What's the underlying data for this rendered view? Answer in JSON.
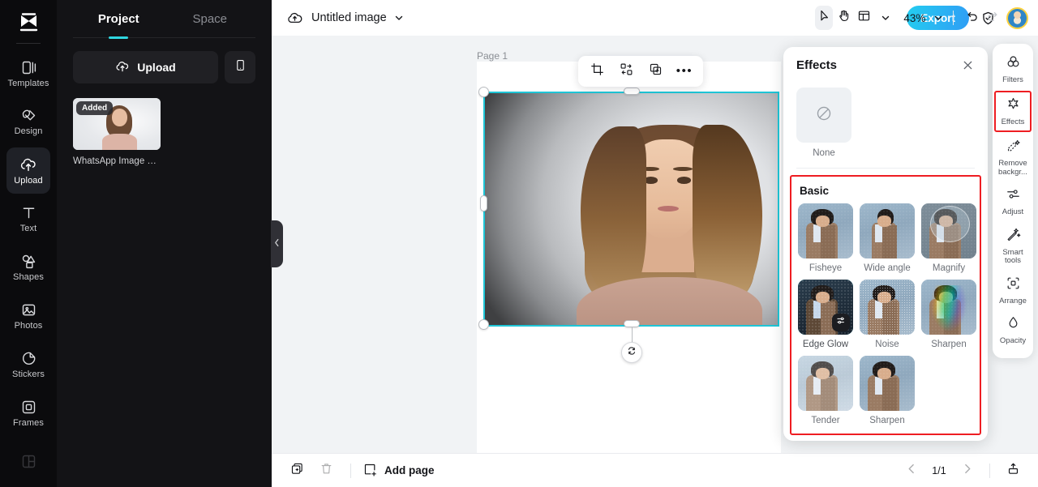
{
  "left_rail": {
    "logo_name": "capcut-logo",
    "items": [
      {
        "label": "Templates",
        "icon": "templates-icon",
        "active": false
      },
      {
        "label": "Design",
        "icon": "design-icon",
        "active": false
      },
      {
        "label": "Upload",
        "icon": "upload-cloud-icon",
        "active": true
      },
      {
        "label": "Text",
        "icon": "text-icon",
        "active": false
      },
      {
        "label": "Shapes",
        "icon": "shapes-icon",
        "active": false
      },
      {
        "label": "Photos",
        "icon": "photos-icon",
        "active": false
      },
      {
        "label": "Stickers",
        "icon": "stickers-icon",
        "active": false
      },
      {
        "label": "Frames",
        "icon": "frames-icon",
        "active": false
      }
    ]
  },
  "side_panel": {
    "tabs": [
      {
        "label": "Project",
        "active": true
      },
      {
        "label": "Space",
        "active": false
      }
    ],
    "upload_button": "Upload",
    "mobile_button_icon": "mobile-phone-icon",
    "assets": [
      {
        "badge": "Added",
        "name": "WhatsApp Image 20..."
      }
    ],
    "collapse_icon": "chevron-left-icon"
  },
  "topbar": {
    "cloud_icon": "cloud-saved-icon",
    "doc_title": "Untitled image",
    "title_caret": "chevron-down-icon",
    "tools": [
      {
        "name": "select-tool",
        "icon": "cursor-arrow-icon",
        "active": true
      },
      {
        "name": "hand-tool",
        "icon": "hand-icon",
        "active": false
      },
      {
        "name": "view-layout-tool",
        "icon": "layout-grid-icon",
        "active": false
      }
    ],
    "view_caret": "chevron-down-icon",
    "zoom_value": "43%",
    "zoom_caret": "chevron-down-icon",
    "undo_icon": "undo-arrow-icon",
    "redo_icon": "redo-arrow-icon",
    "export_label": "Export",
    "shield_icon": "shield-check-icon",
    "avatar_name": "user-avatar"
  },
  "canvas": {
    "page_label": "Page 1",
    "float_toolbar": [
      {
        "name": "crop-button",
        "icon": "crop-icon"
      },
      {
        "name": "replace-button",
        "icon": "replace-image-icon"
      },
      {
        "name": "duplicate-button",
        "icon": "duplicate-icon"
      },
      {
        "name": "more-button",
        "icon": "more-dots-icon",
        "label": "•••"
      }
    ],
    "rotate_icon": "rotate-handle-icon",
    "selection_color": "#1ec5d6"
  },
  "bottombar": {
    "duplicate_page_icon": "duplicate-page-icon",
    "delete_page_icon": "trash-icon",
    "add_page_label": "Add page",
    "add_page_icon": "add-page-icon",
    "prev_icon": "chevron-left-icon",
    "page_count": "1/1",
    "next_icon": "chevron-right-icon",
    "export_icon": "export-upload-icon"
  },
  "effects_panel": {
    "title": "Effects",
    "close_icon": "close-icon",
    "none": {
      "label": "None",
      "icon": "no-effect-icon"
    },
    "section_title": "Basic",
    "highlight_color": "#ee1d22",
    "effects": [
      {
        "label": "Fisheye",
        "variant": "v-fish",
        "selected": false
      },
      {
        "label": "Wide angle",
        "variant": "v-wide",
        "selected": false
      },
      {
        "label": "Magnify",
        "variant": "v-mag",
        "selected": false
      },
      {
        "label": "Edge Glow",
        "variant": "v-glow",
        "selected": true,
        "badge_icon": "adjust-sliders-icon"
      },
      {
        "label": "Noise",
        "variant": "v-noise",
        "selected": false
      },
      {
        "label": "Sharpen",
        "variant": "v-sharp",
        "selected": false
      },
      {
        "label": "Tender",
        "variant": "v-tender",
        "selected": false
      },
      {
        "label": "Sharpen",
        "variant": "v-fish",
        "selected": false
      }
    ]
  },
  "right_rail": {
    "items": [
      {
        "label": "Filters",
        "icon": "filters-icon",
        "highlight": false
      },
      {
        "label": "Effects",
        "icon": "effects-sparkle-icon",
        "highlight": true
      },
      {
        "label": "Remove backgr...",
        "icon": "remove-background-icon",
        "highlight": false
      },
      {
        "label": "Adjust",
        "icon": "adjust-sliders-icon",
        "highlight": false
      },
      {
        "label": "Smart tools",
        "icon": "smart-tools-wand-icon",
        "highlight": false
      },
      {
        "label": "Arrange",
        "icon": "arrange-icon",
        "highlight": false
      },
      {
        "label": "Opacity",
        "icon": "opacity-drop-icon",
        "highlight": false
      }
    ]
  }
}
